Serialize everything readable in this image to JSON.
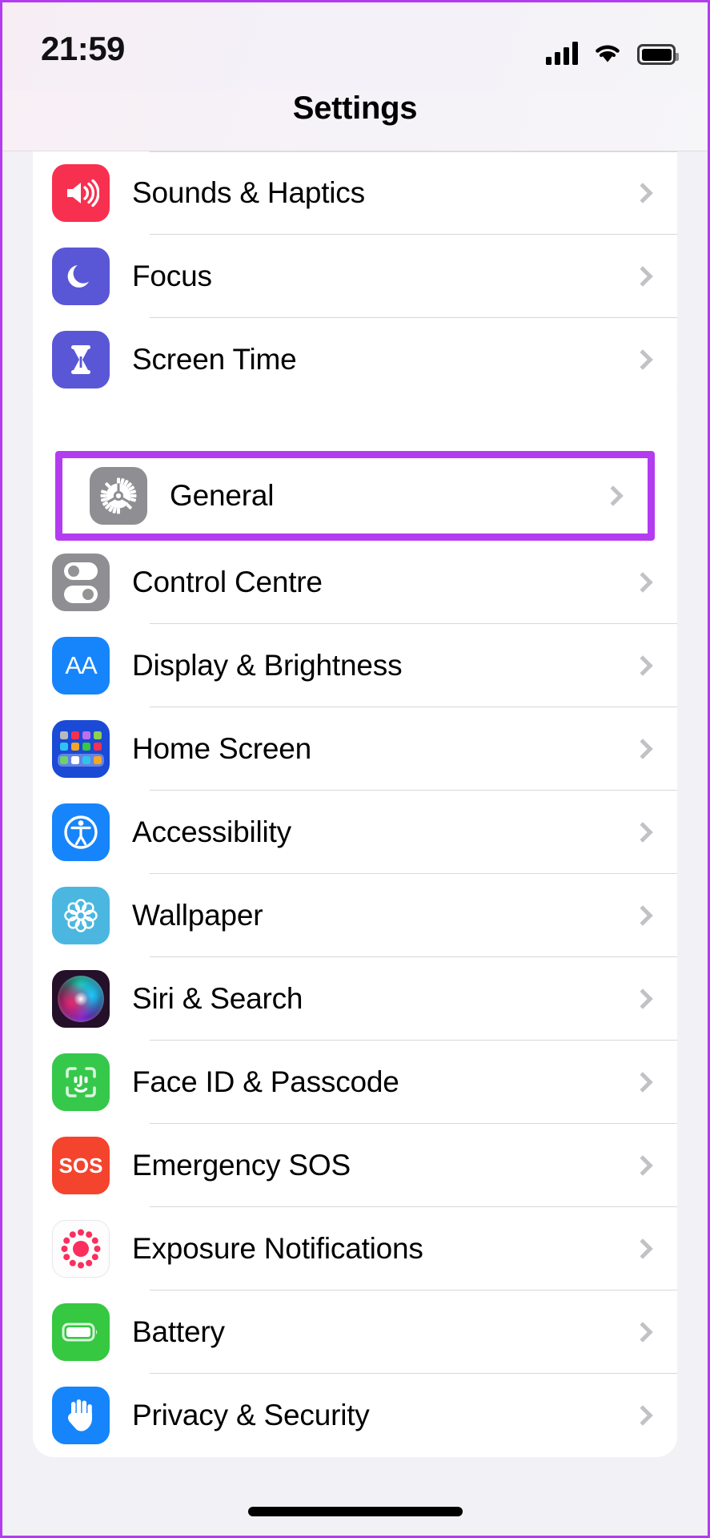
{
  "status_bar": {
    "time": "21:59",
    "cellular_icon": "cellular-bars-icon",
    "wifi_icon": "wifi-icon",
    "battery_icon": "battery-full-icon"
  },
  "nav": {
    "title": "Settings"
  },
  "highlight": {
    "color": "#b43cf0",
    "target_row": "General"
  },
  "groups": [
    {
      "id": "group-1",
      "rows": [
        {
          "label": "Sounds & Haptics",
          "icon": "sounds-haptics-icon",
          "icon_color": "#f8304f",
          "chevron": "chevron-right-icon"
        },
        {
          "label": "Focus",
          "icon": "focus-moon-icon",
          "icon_color": "#5a57d6",
          "chevron": "chevron-right-icon"
        },
        {
          "label": "Screen Time",
          "icon": "screen-time-hourglass-icon",
          "icon_color": "#5a57d6",
          "chevron": "chevron-right-icon"
        }
      ]
    },
    {
      "id": "group-2",
      "rows": [
        {
          "label": "General",
          "icon": "general-gear-icon",
          "icon_color": "#8e8e93",
          "chevron": "chevron-right-icon",
          "highlighted": true
        },
        {
          "label": "Control Centre",
          "icon": "control-centre-toggles-icon",
          "icon_color": "#8e8e93",
          "chevron": "chevron-right-icon"
        },
        {
          "label": "Display & Brightness",
          "icon": "display-brightness-aa-icon",
          "icon_color": "#1685fb",
          "chevron": "chevron-right-icon"
        },
        {
          "label": "Home Screen",
          "icon": "home-screen-grid-icon",
          "icon_color": "#1a4ad6",
          "chevron": "chevron-right-icon"
        },
        {
          "label": "Accessibility",
          "icon": "accessibility-person-icon",
          "icon_color": "#1685fb",
          "chevron": "chevron-right-icon"
        },
        {
          "label": "Wallpaper",
          "icon": "wallpaper-flower-icon",
          "icon_color": "#4bb7e0",
          "chevron": "chevron-right-icon"
        },
        {
          "label": "Siri & Search",
          "icon": "siri-orb-icon",
          "icon_color": "#241028",
          "chevron": "chevron-right-icon"
        },
        {
          "label": "Face ID & Passcode",
          "icon": "face-id-icon",
          "icon_color": "#36c84b",
          "chevron": "chevron-right-icon"
        },
        {
          "label": "Emergency SOS",
          "icon": "emergency-sos-icon",
          "icon_color": "#f4442e",
          "chevron": "chevron-right-icon"
        },
        {
          "label": "Exposure Notifications",
          "icon": "exposure-notifications-icon",
          "icon_color": "#fdfdfd",
          "chevron": "chevron-right-icon"
        },
        {
          "label": "Battery",
          "icon": "battery-icon",
          "icon_color": "#35c840",
          "chevron": "chevron-right-icon"
        },
        {
          "label": "Privacy & Security",
          "icon": "privacy-hand-icon",
          "icon_color": "#1685fb",
          "chevron": "chevron-right-icon"
        }
      ]
    }
  ],
  "home_indicator": "home-indicator-bar"
}
